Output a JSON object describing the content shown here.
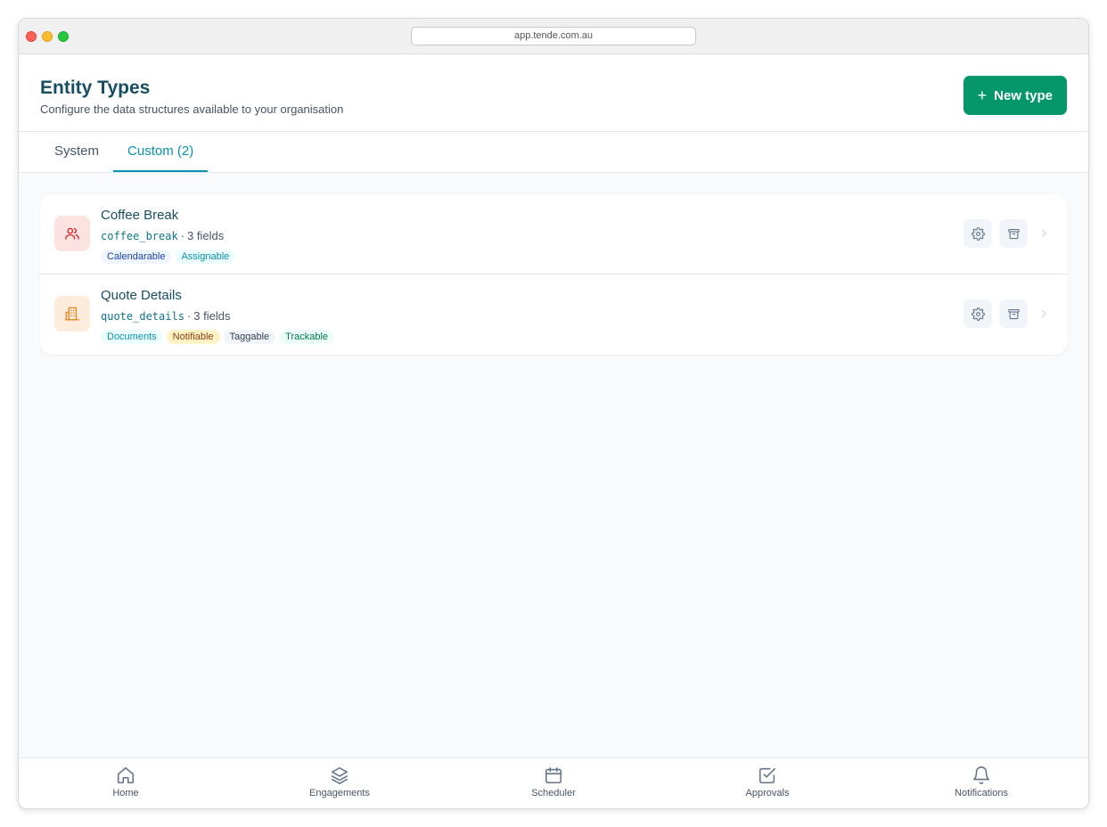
{
  "browser": {
    "url": "app.tende.com.au"
  },
  "header": {
    "title": "Entity Types",
    "subtitle": "Configure the data structures available to your organisation",
    "new_button_plus": "+",
    "new_button_label": "New type"
  },
  "tabs": [
    {
      "label": "System",
      "active": false
    },
    {
      "label": "Custom (2)",
      "active": true
    }
  ],
  "entities": [
    {
      "name": "Coffee Break",
      "key": "coffee_break",
      "separator": "·",
      "fields": "3 fields",
      "icon": "users-icon",
      "icon_color": "#dc2626",
      "tags": [
        "Calendarable",
        "Assignable"
      ]
    },
    {
      "name": "Quote Details",
      "key": "quote_details",
      "separator": "·",
      "fields": "3 fields",
      "icon": "building-icon",
      "icon_color": "#ea8a27",
      "tags": [
        "Documents",
        "Notifiable",
        "Taggable",
        "Trackable"
      ]
    }
  ],
  "bottom_nav": [
    {
      "label": "Home",
      "icon": "home-icon"
    },
    {
      "label": "Engagements",
      "icon": "layers-icon"
    },
    {
      "label": "Scheduler",
      "icon": "calendar-icon"
    },
    {
      "label": "Approvals",
      "icon": "check-square-icon"
    },
    {
      "label": "Notifications",
      "icon": "bell-icon"
    }
  ],
  "colors": {
    "accent": "#0891b2",
    "primary_button": "#059669",
    "title": "#164e63"
  }
}
